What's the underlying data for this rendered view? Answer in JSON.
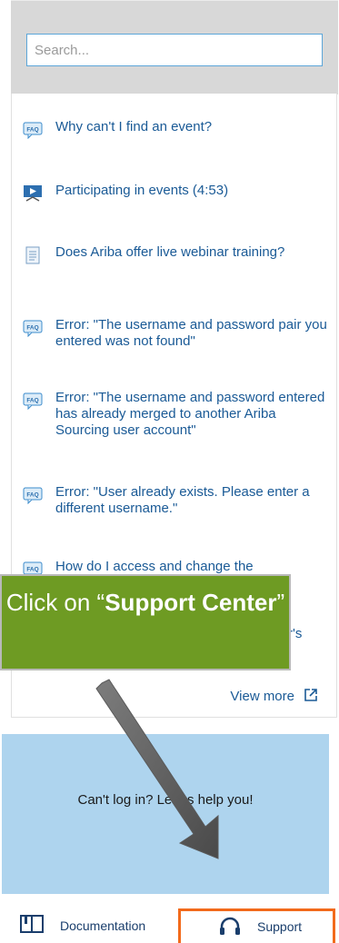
{
  "search": {
    "placeholder": "Search..."
  },
  "faq_items": [
    {
      "icon": "faq-icon",
      "text": "Why can't I find an event?"
    },
    {
      "icon": "video-icon",
      "text": "Participating in events (4:53)"
    },
    {
      "icon": "document-icon",
      "text": "Does Ariba offer live webinar training?"
    },
    {
      "icon": "faq-icon",
      "text": "Error: \"The username and password pair you entered was not found\""
    },
    {
      "icon": "faq-icon",
      "text": "Error: \"The username and password entered has already merged to another Ariba Sourcing user account\""
    },
    {
      "icon": "faq-icon",
      "text": "Error: \"User already exists. Please enter a different username.\""
    },
    {
      "icon": "faq-icon",
      "text": "How do I access and change the"
    },
    {
      "icon": "faq-icon",
      "text": "r's"
    }
  ],
  "view_more": "View more",
  "help": {
    "text": "Can't log in? Let us help you!"
  },
  "bottom_bar": {
    "documentation": "Documentation",
    "support": "Support"
  },
  "callout": {
    "prefix": "Click on “",
    "bold": "Support Center",
    "suffix": "”"
  },
  "colors": {
    "link": "#1a5a96",
    "callout_bg": "#6e9b23",
    "help_bg": "#aed4ee",
    "highlight": "#f26a1b"
  }
}
